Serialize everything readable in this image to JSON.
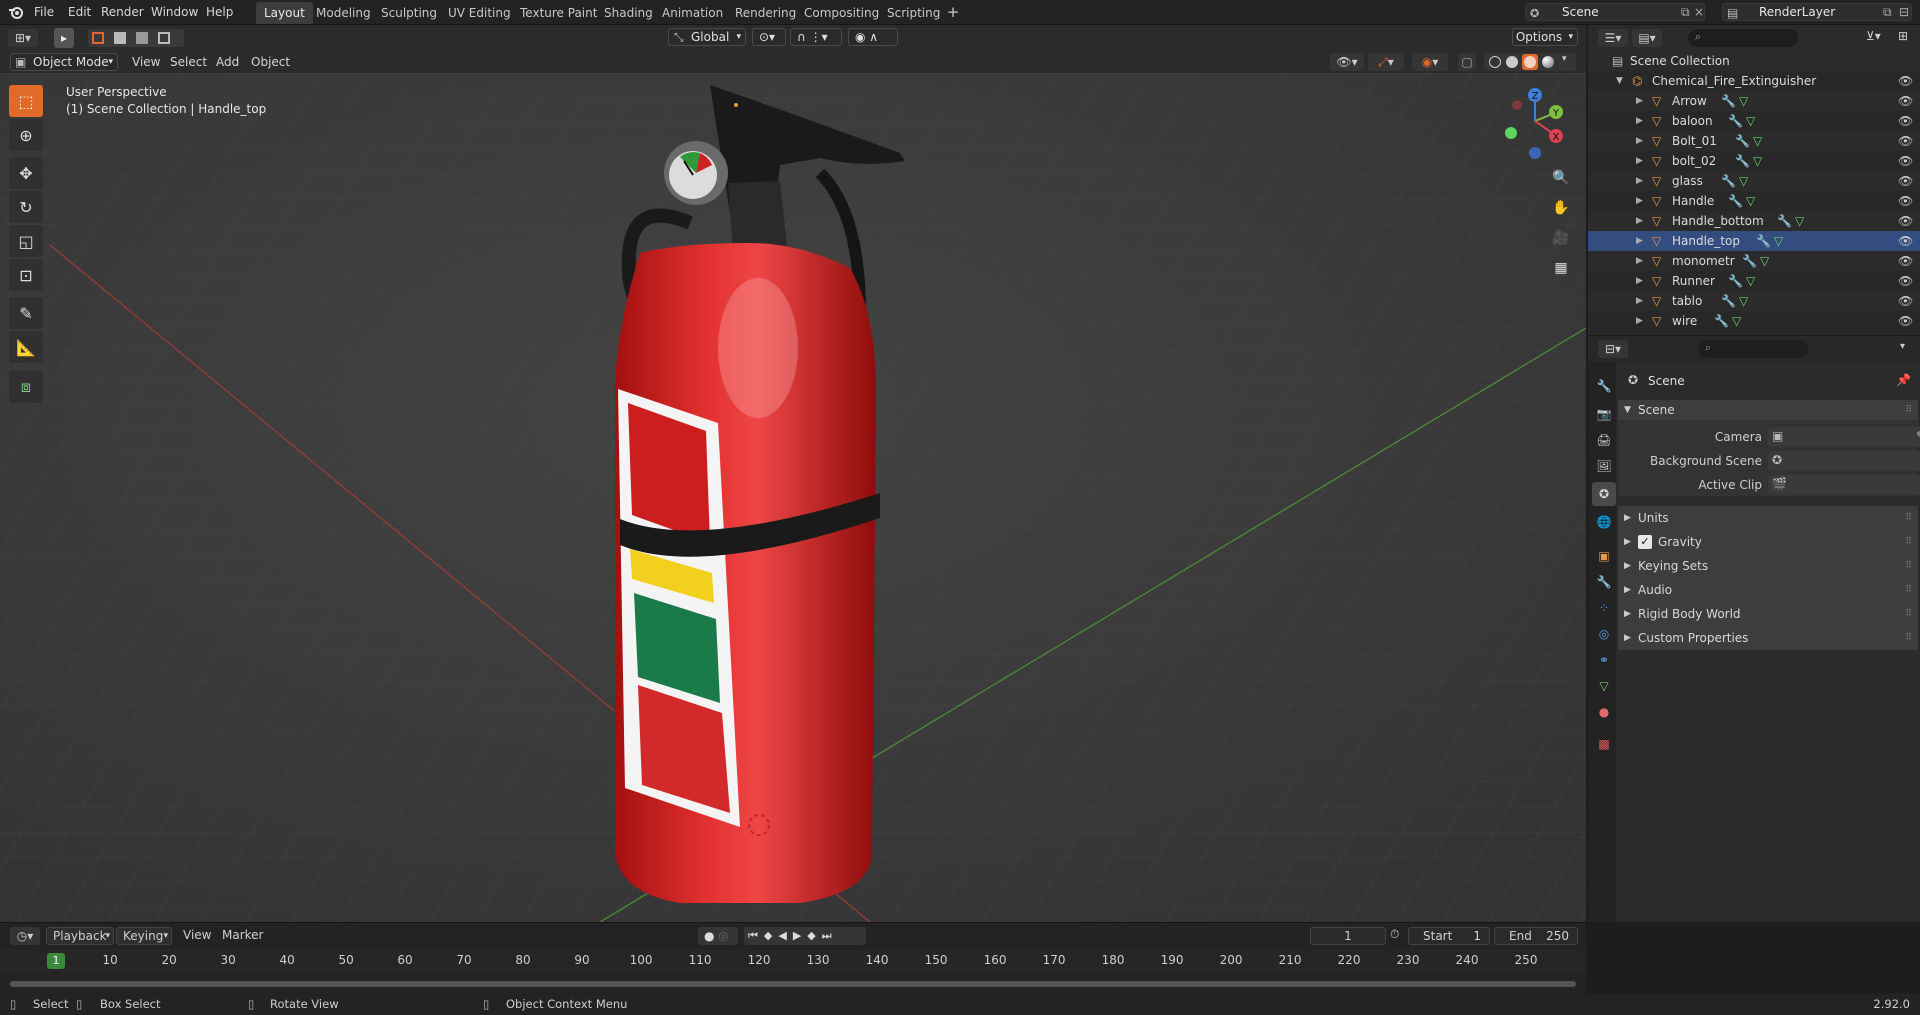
{
  "menu": [
    "File",
    "Edit",
    "Render",
    "Window",
    "Help"
  ],
  "workspaces": [
    "Layout",
    "Modeling",
    "Sculpting",
    "UV Editing",
    "Texture Paint",
    "Shading",
    "Animation",
    "Rendering",
    "Compositing",
    "Scripting"
  ],
  "active_workspace": "Layout",
  "scene_name": "Scene",
  "render_layer": "RenderLayer",
  "transform_orientation": "Global",
  "options_label": "Options",
  "viewport": {
    "mode": "Object Mode",
    "menus": [
      "View",
      "Select",
      "Add",
      "Object"
    ],
    "overlay_title": "User Perspective",
    "overlay_subtitle": "(1) Scene Collection | Handle_top",
    "gizmo_axes": {
      "z": "Z",
      "y": "Y",
      "x": "X"
    }
  },
  "outliner": {
    "root": "Scene Collection",
    "collection": "Chemical_Fire_Extinguisher",
    "objects": [
      "Arrow",
      "baloon",
      "Bolt_01",
      "bolt_02",
      "glass",
      "Handle",
      "Handle_bottom",
      "Handle_top",
      "monometr",
      "Runner",
      "tablo",
      "wire"
    ],
    "selected": "Handle_top"
  },
  "properties": {
    "breadcrumb": "Scene",
    "panel": "Scene",
    "fields": [
      "Camera",
      "Background Scene",
      "Active Clip"
    ],
    "subpanels": [
      "Units",
      "Gravity",
      "Keying Sets",
      "Audio",
      "Rigid Body World",
      "Custom Properties"
    ],
    "gravity_checked": true
  },
  "timeline": {
    "menus": [
      "Playback",
      "Keying",
      "View",
      "Marker"
    ],
    "current_frame": "1",
    "start_label": "Start",
    "start": "1",
    "end_label": "End",
    "end": "250",
    "ticks": [
      "1",
      "10",
      "20",
      "30",
      "40",
      "50",
      "60",
      "70",
      "80",
      "90",
      "100",
      "110",
      "120",
      "130",
      "140",
      "150",
      "160",
      "170",
      "180",
      "190",
      "200",
      "210",
      "220",
      "230",
      "240",
      "250"
    ]
  },
  "statusbar": {
    "select": "Select",
    "box_select": "Box Select",
    "rotate_view": "Rotate View",
    "context_menu": "Object Context Menu",
    "version": "2.92.0"
  },
  "colors": {
    "accent": "#e06a2a",
    "active_ws": "#3d3d3d",
    "x_axis": "#d9424f",
    "y_axis": "#7fbf3f",
    "z_axis": "#3d7fd9",
    "grid_bg": "#3a3a3a"
  }
}
